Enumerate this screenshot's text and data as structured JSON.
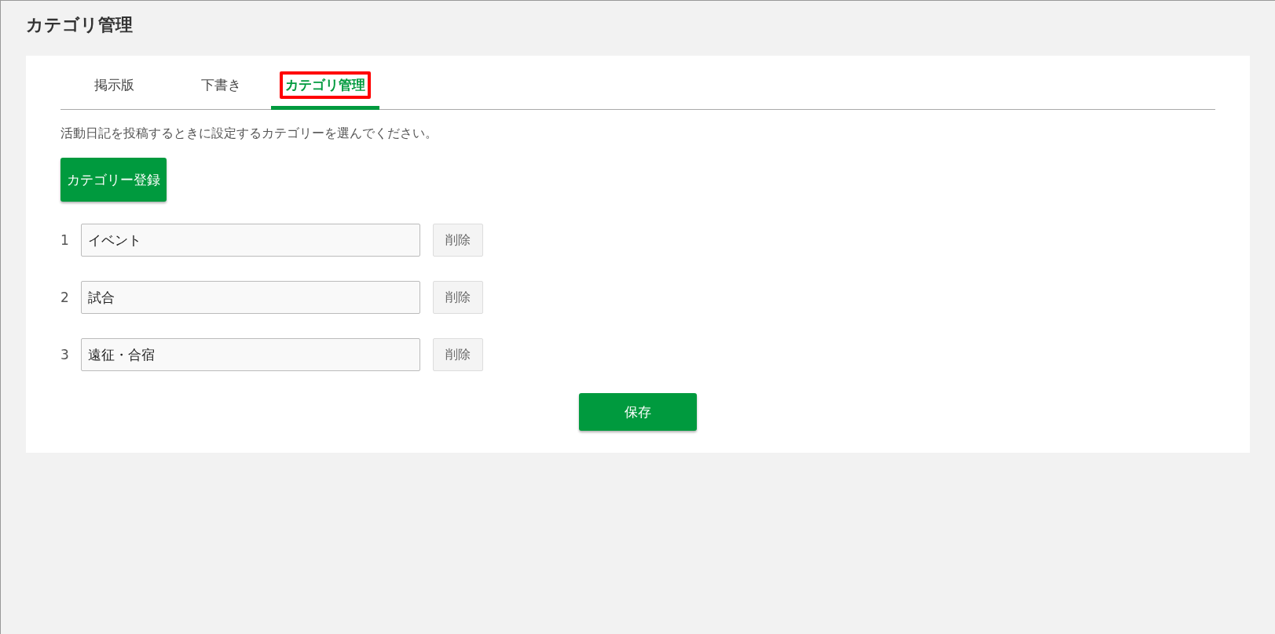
{
  "page_title": "カテゴリ管理",
  "tabs": [
    {
      "label": "掲示版",
      "selected": false,
      "highlighted": false
    },
    {
      "label": "下書き",
      "selected": false,
      "highlighted": false
    },
    {
      "label": "カテゴリ管理",
      "selected": true,
      "highlighted": true
    }
  ],
  "description": "活動日記を投稿するときに設定するカテゴリーを選んでください。",
  "register_button": "カテゴリー登録",
  "categories": [
    {
      "number": "1",
      "value": "イベント",
      "delete_button": "削除"
    },
    {
      "number": "2",
      "value": "試合",
      "delete_button": "削除"
    },
    {
      "number": "3",
      "value": "遠征・合宿",
      "delete_button": "削除"
    }
  ],
  "save_button": "保存"
}
